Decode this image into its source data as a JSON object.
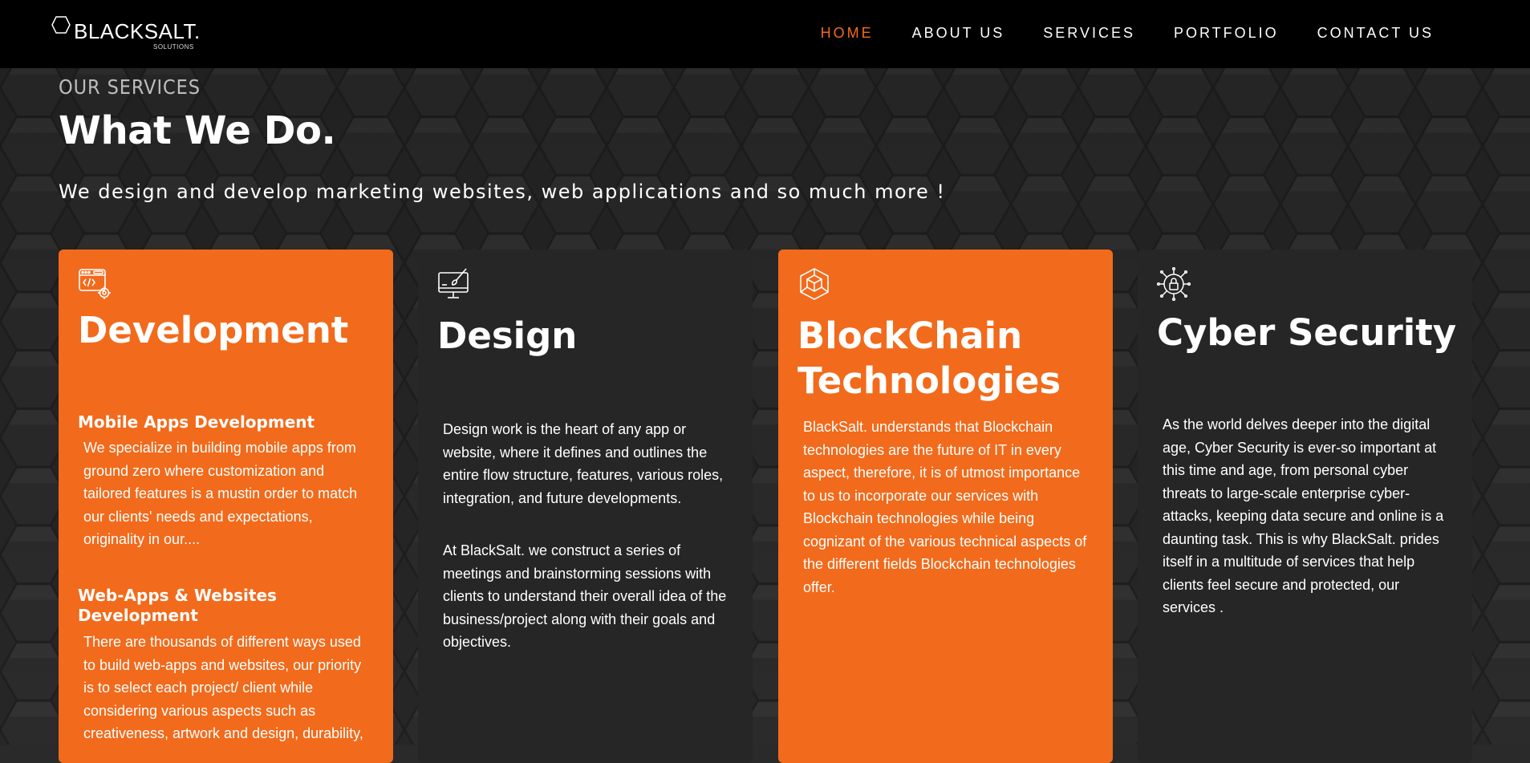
{
  "brand": {
    "name": "BLACKSALT.",
    "sub": "SOLUTIONS"
  },
  "nav": {
    "items": [
      {
        "label": "HOME",
        "active": true
      },
      {
        "label": "ABOUT US",
        "active": false
      },
      {
        "label": "SERVICES",
        "active": false
      },
      {
        "label": "PORTFOLIO",
        "active": false
      },
      {
        "label": "CONTACT US",
        "active": false
      }
    ]
  },
  "hero": {
    "eyebrow": "OUR SERVICES",
    "title": "What We Do.",
    "subtitle": "We design and develop marketing websites, web applications and so much more !"
  },
  "colors": {
    "accent": "#f26a1b",
    "card_dark": "#262626",
    "navbar": "#000000",
    "background": "#2b2b2b"
  },
  "cards": [
    {
      "icon": "code-window-gear-icon",
      "title": "Development",
      "sections": [
        {
          "heading": "Mobile Apps Development",
          "text": "We specialize in building mobile apps from ground zero where customization and tailored features is a mustin order to match our clients' needs and expectations, originality in our...."
        },
        {
          "heading": "Web-Apps & Websites Development",
          "text": "There are thousands of different ways used to build web-apps and websites, our priority is to select each project/ client while considering various aspects such as creativeness, artwork and design, durability,"
        }
      ]
    },
    {
      "icon": "monitor-brush-icon",
      "title": "Design",
      "paragraphs": [
        "Design work is the heart of any app or website, where it defines and outlines the entire flow structure, features, various roles, integration, and future developments.",
        "At BlackSalt. we construct a series of meetings and brainstorming sessions with clients to understand their overall idea of the business/project along with their goals and objectives."
      ]
    },
    {
      "icon": "blockchain-cube-icon",
      "title": "BlockChain Technologies",
      "paragraphs": [
        "BlackSalt. understands that Blockchain technologies are the future of IT in every aspect, therefore, it is of utmost importance to us to incorporate our services with Blockchain technologies while being cognizant of the various technical aspects of the different fields Blockchain technologies offer."
      ]
    },
    {
      "icon": "circuit-lock-icon",
      "title": "Cyber Security",
      "paragraphs": [
        "As the world delves deeper into the digital age, Cyber Security is ever-so important at this time and age, from personal cyber threats to large-scale enterprise cyber-attacks, keeping data secure and online is a daunting task. This is why BlackSalt. prides itself in a multitude of services that help clients feel secure and protected, our services ."
      ]
    }
  ]
}
